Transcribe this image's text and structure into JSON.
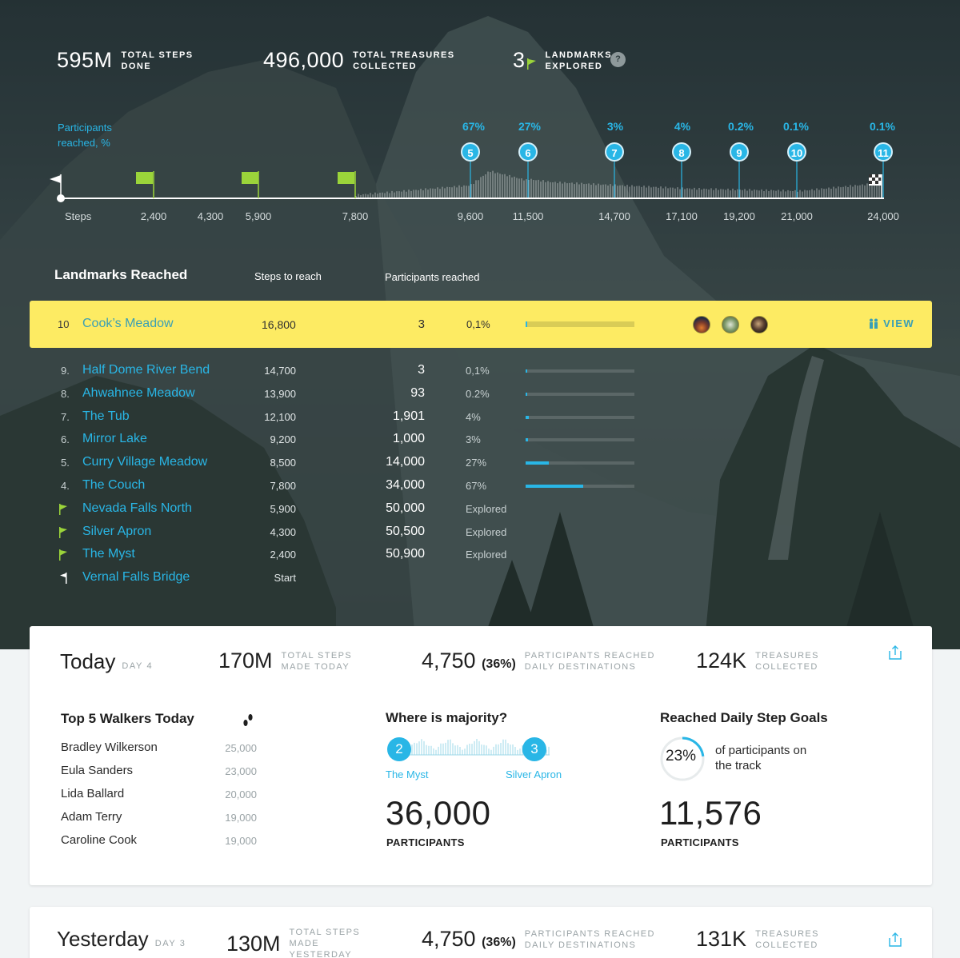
{
  "summary": {
    "total_steps": {
      "value": "595M",
      "label": "TOTAL STEPS DONE"
    },
    "total_treasures": {
      "value": "496,000",
      "label": "TOTAL TREASURES COLLECTED"
    },
    "landmarks": {
      "value": "3",
      "label": "LANDMARKS EXPLORED",
      "help": "?"
    }
  },
  "track": {
    "participants_label": "Participants reached, %",
    "steps_label": "Steps",
    "ticks": [
      "2,400",
      "4,300",
      "5,900",
      "7,800",
      "9,600",
      "11,500",
      "14,700",
      "17,100",
      "19,200",
      "21,000",
      "24,000"
    ],
    "pins": [
      {
        "num": "5",
        "pct": "67%"
      },
      {
        "num": "6",
        "pct": "27%"
      },
      {
        "num": "7",
        "pct": "3%"
      },
      {
        "num": "8",
        "pct": "4%"
      },
      {
        "num": "9",
        "pct": "0.2%"
      },
      {
        "num": "10",
        "pct": "0.1%"
      },
      {
        "num": "11",
        "pct": "0.1%"
      }
    ]
  },
  "landmarks_table": {
    "title": "Landmarks Reached",
    "col_steps": "Steps to reach",
    "col_participants": "Participants reached",
    "highlighted": {
      "num": "10",
      "name": "Cook’s Meadow",
      "steps": "16,800",
      "count": "3",
      "pct": "0,1%",
      "fill": 0.001,
      "view": "VIEW"
    },
    "rows": [
      {
        "num": "9.",
        "name": "Half Dome River Bend",
        "steps": "14,700",
        "count": "3",
        "pct": "0,1%",
        "fill": 0.001
      },
      {
        "num": "8.",
        "name": "Ahwahnee Meadow",
        "steps": "13,900",
        "count": "93",
        "pct": "0.2%",
        "fill": 0.002
      },
      {
        "num": "7.",
        "name": "The Tub",
        "steps": "12,100",
        "count": "1,901",
        "pct": "4%",
        "fill": 0.04
      },
      {
        "num": "6.",
        "name": "Mirror Lake",
        "steps": "9,200",
        "count": "1,000",
        "pct": "3%",
        "fill": 0.03
      },
      {
        "num": "5.",
        "name": "Curry Village Meadow",
        "steps": "8,500",
        "count": "14,000",
        "pct": "27%",
        "fill": 0.27
      },
      {
        "num": "4.",
        "name": "The Couch",
        "steps": "7,800",
        "count": "34,000",
        "pct": "67%",
        "fill": 0.67
      },
      {
        "num": "",
        "name": "Nevada Falls North",
        "steps": "5,900",
        "count": "50,000",
        "pct": "Explored",
        "flag": "explored"
      },
      {
        "num": "",
        "name": "Silver Apron",
        "steps": "4,300",
        "count": "50,500",
        "pct": "Explored",
        "flag": "explored"
      },
      {
        "num": "",
        "name": "The Myst",
        "steps": "2,400",
        "count": "50,900",
        "pct": "Explored",
        "flag": "explored"
      },
      {
        "num": "",
        "name": "Vernal Falls Bridge",
        "steps": "Start",
        "count": "",
        "pct": "",
        "flag": "start"
      }
    ]
  },
  "today": {
    "title": "Today",
    "day": "DAY 4",
    "steps": {
      "value": "170M",
      "label": "TOTAL STEPS MADE TODAY"
    },
    "participants": {
      "value": "4,750",
      "paren": "(36%)",
      "label": "PARTICIPANTS REACHED DAILY DESTINATIONS"
    },
    "treasures": {
      "value": "124K",
      "label": "TREASURES COLLECTED"
    },
    "walkers_title": "Top 5 Walkers Today",
    "walkers": [
      {
        "name": "Bradley Wilkerson",
        "steps": "25,000"
      },
      {
        "name": "Eula Sanders",
        "steps": "23,000"
      },
      {
        "name": "Lida Ballard",
        "steps": "20,000"
      },
      {
        "name": "Adam Terry",
        "steps": "19,000"
      },
      {
        "name": "Caroline Cook",
        "steps": "19,000"
      }
    ],
    "majority_title": "Where is majority?",
    "majority_from": {
      "num": "2",
      "name": "The Myst"
    },
    "majority_to": {
      "num": "3",
      "name": "Silver Apron"
    },
    "majority_count": "36,000",
    "majority_caption": "PARTICIPANTS",
    "goals_title": "Reached Daily Step Goals",
    "goals_pct": "23%",
    "goals_fraction": 0.23,
    "goals_text": "of participants on the track",
    "goals_count": "11,576",
    "goals_caption": "PARTICIPANTS"
  },
  "yesterday": {
    "title": "Yesterday",
    "day": "DAY 3",
    "steps": {
      "value": "130M",
      "label": "TOTAL STEPS MADE YESTERDAY"
    },
    "participants": {
      "value": "4,750",
      "paren": "(36%)",
      "label": "PARTICIPANTS REACHED DAILY DESTINATIONS"
    },
    "treasures": {
      "value": "131K",
      "label": "TREASURES COLLECTED"
    }
  },
  "colors": {
    "accent": "#29b6e6",
    "flag": "#9bd43a",
    "highlight": "#fdeb63"
  }
}
